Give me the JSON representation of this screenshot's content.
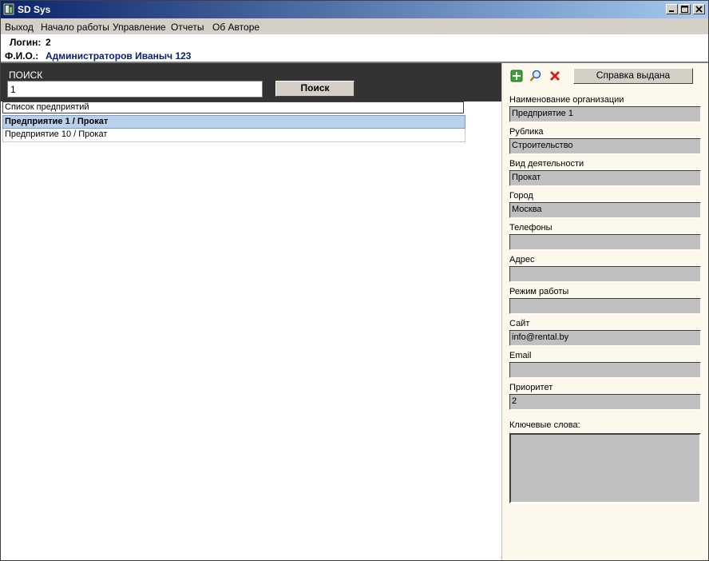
{
  "window": {
    "title": "SD Sys"
  },
  "menu": {
    "items": [
      "Выход",
      "Начало работы",
      "Управление",
      "Отчеты",
      "Об Авторе"
    ]
  },
  "user": {
    "login_label": "Логин:",
    "login_value": "2",
    "fio_label": "Ф.И.О.:",
    "fio_value": "Администраторов Иваныч 123",
    "fio_color": "#0a246a"
  },
  "search": {
    "label": "ПОИСК",
    "value": "1",
    "button_label": "Поиск"
  },
  "list": {
    "header": "Список предприятий",
    "rows": [
      "Предприятие 1 / Прокат",
      "Предприятие 10 / Прокат"
    ],
    "selected_index": 0
  },
  "toolbar": {
    "icons": [
      "add-icon",
      "search-icon",
      "delete-icon"
    ],
    "help_button_label": "Справка выдана"
  },
  "details": {
    "fields": [
      {
        "label": "Наименование организации",
        "value": "Предприятие 1"
      },
      {
        "label": "Рублика",
        "value": "Строительство"
      },
      {
        "label": "Вид деятельности",
        "value": "Прокат"
      },
      {
        "label": "Город",
        "value": "Москва"
      },
      {
        "label": "Телефоны",
        "value": ""
      },
      {
        "label": "Адрес",
        "value": ""
      },
      {
        "label": "Режим работы",
        "value": ""
      },
      {
        "label": "Сайт",
        "value": "info@rental.by"
      },
      {
        "label": "Email",
        "value": ""
      },
      {
        "label": "Приоритет",
        "value": "2"
      }
    ],
    "keywords_label": "Ключевые слова:",
    "keywords_value": ""
  },
  "colors": {
    "title_gradient_start": "#0a246a",
    "title_gradient_end": "#a6caf0",
    "selection": "#b9d1ea",
    "search_panel": "#333333",
    "right_panel": "#fdf8ec"
  }
}
